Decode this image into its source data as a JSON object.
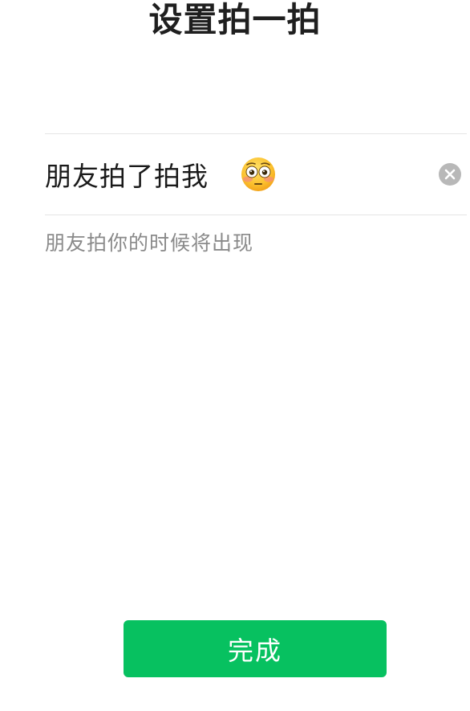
{
  "header": {
    "title": "设置拍一拍"
  },
  "input": {
    "value": "朋友拍了拍我",
    "emoji_icon": "flushed-face-icon",
    "clear_icon": "clear-circle-icon"
  },
  "hint": {
    "text": "朋友拍你的时候将出现"
  },
  "actions": {
    "done_label": "完成",
    "done_color": "#07c160"
  }
}
